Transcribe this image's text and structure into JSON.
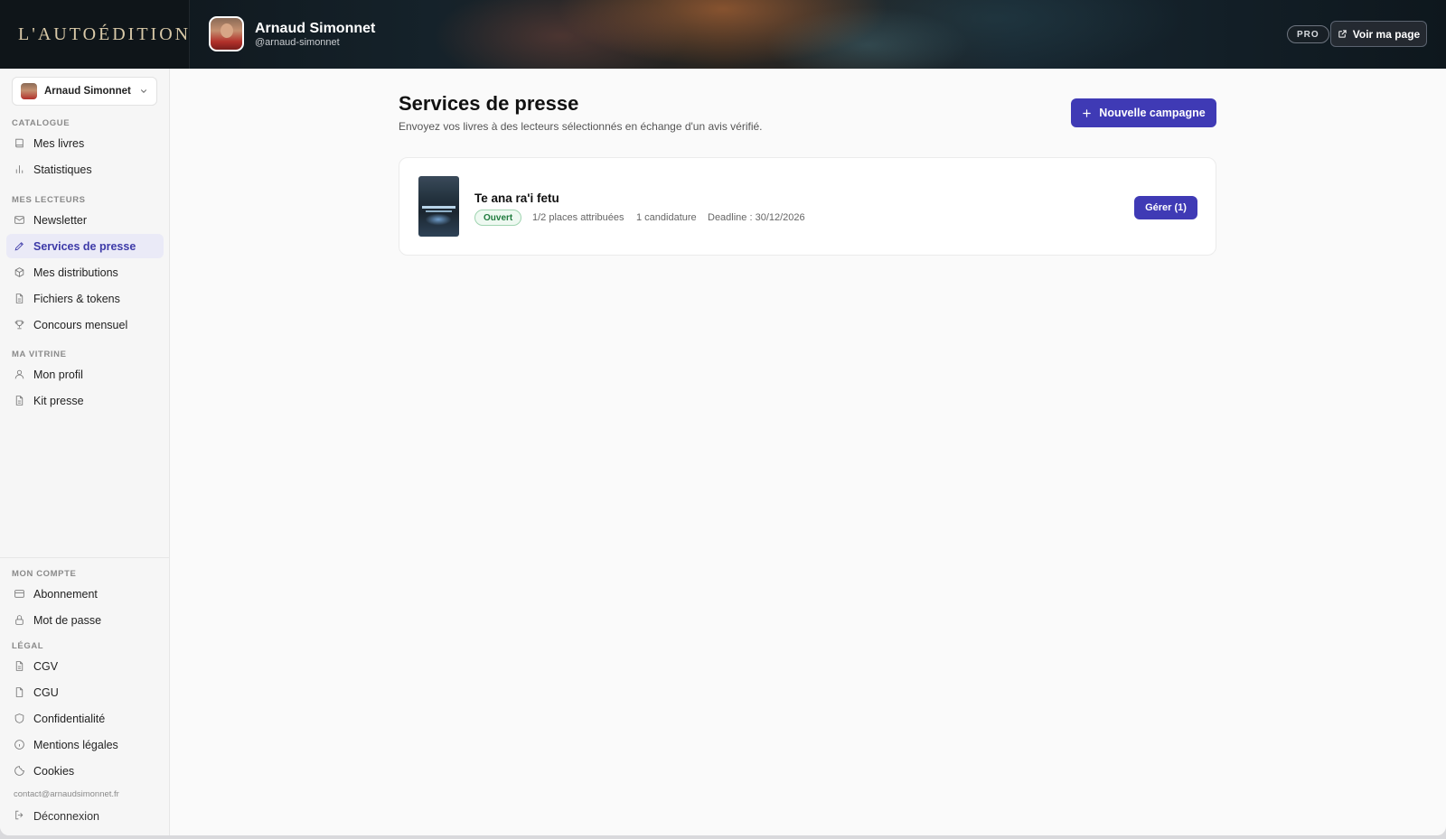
{
  "header": {
    "logo": "L'AUTOÉDITION",
    "profile_name": "Arnaud Simonnet",
    "profile_handle": "@arnaud-simonnet",
    "badge": "PRO",
    "view_page_label": "Voir ma page"
  },
  "sidebar": {
    "user_select_name": "Arnaud Simonnet",
    "sections": {
      "catalogue": "CATALOGUE",
      "readers": "MES LECTEURS",
      "showcase": "MA VITRINE",
      "account": "MON COMPTE",
      "legal": "LÉGAL"
    },
    "items": {
      "books": "Mes livres",
      "stats": "Statistiques",
      "newsletter": "Newsletter",
      "press": "Services de presse",
      "distributions": "Mes distributions",
      "files": "Fichiers & tokens",
      "contest": "Concours mensuel",
      "profile": "Mon profil",
      "press_kit": "Kit presse",
      "subscription": "Abonnement",
      "password": "Mot de passe",
      "cgv": "CGV",
      "cgu": "CGU",
      "privacy": "Confidentialité",
      "legal_notice": "Mentions légales",
      "cookies": "Cookies"
    },
    "contact": "contact@arnaudsimonnet.fr",
    "logout": "Déconnexion"
  },
  "main": {
    "title": "Services de presse",
    "subtitle": "Envoyez vos livres à des lecteurs sélectionnés en échange d'un avis vérifié.",
    "new_campaign_label": "Nouvelle campagne",
    "campaigns": [
      {
        "title": "Te ana ra'i fetu",
        "status": "Ouvert",
        "places": "1/2 places attribuées",
        "applications": "1 candidature",
        "deadline": "Deadline : 30/12/2026",
        "manage_label": "Gérer (1)"
      }
    ]
  },
  "colors": {
    "accent": "#3f3ab5",
    "active_nav_bg": "#eaeaf7",
    "status_open": "#1f7a3d"
  }
}
